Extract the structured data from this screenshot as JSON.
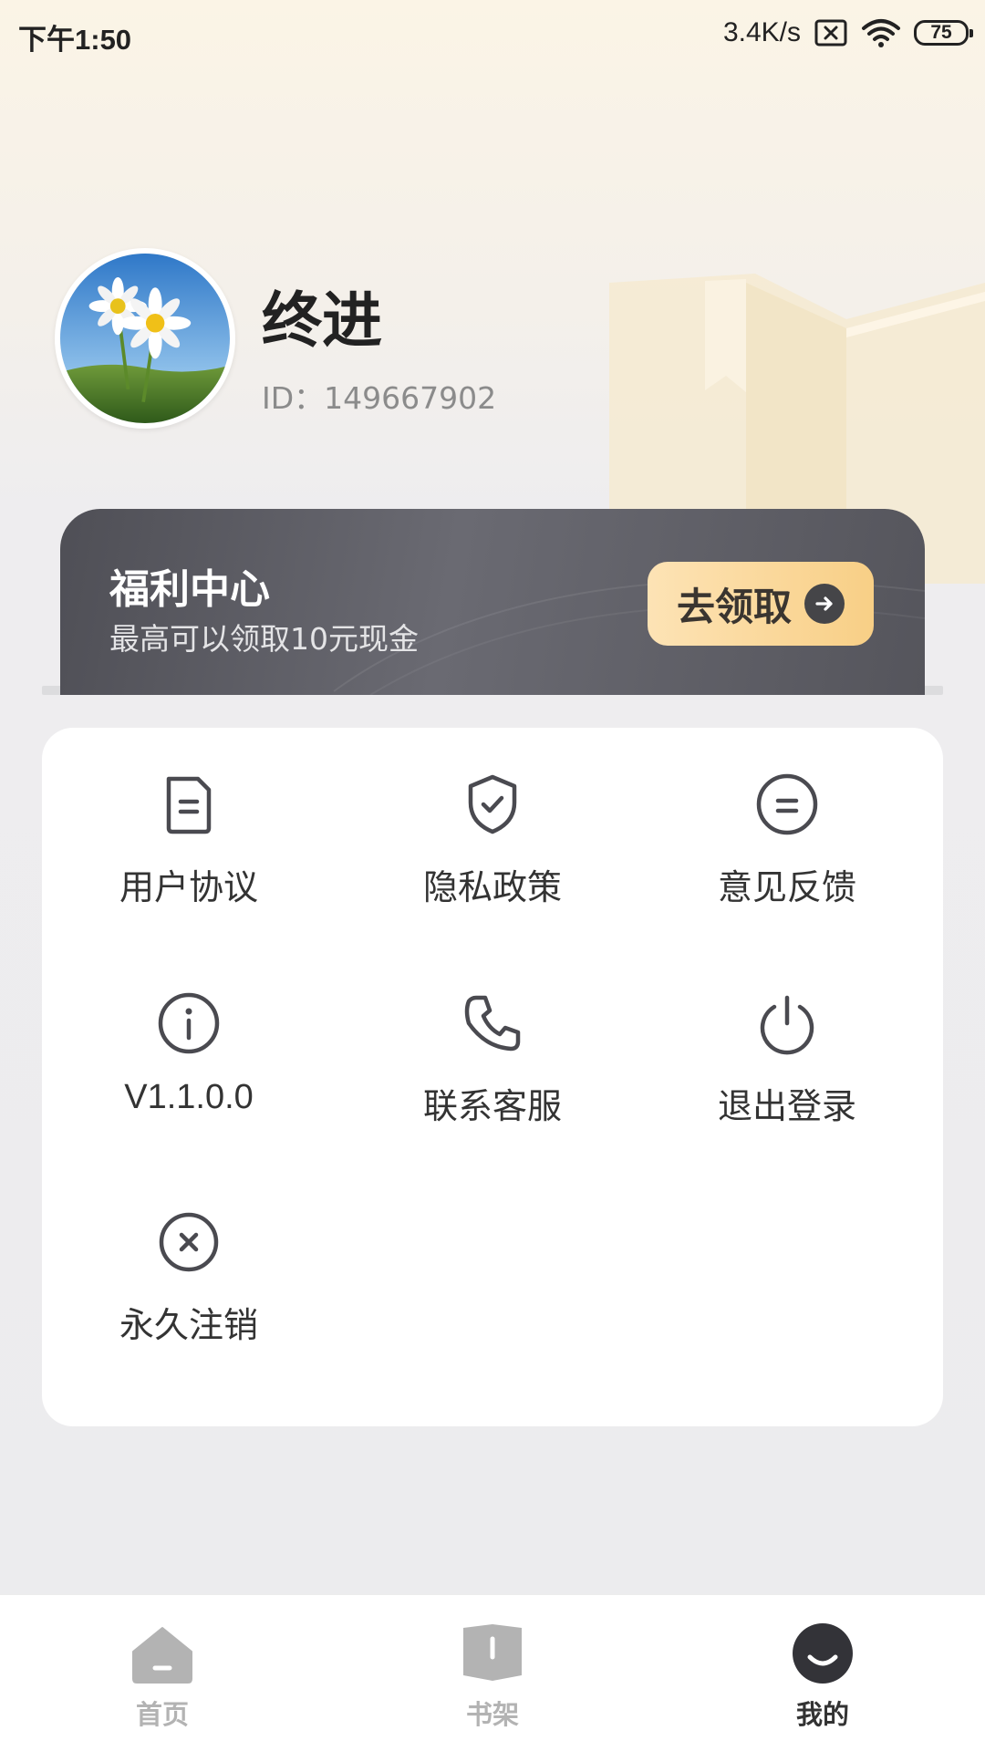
{
  "status_bar": {
    "time": "下午1:50",
    "net_speed": "3.4K/s",
    "battery": "75"
  },
  "profile": {
    "name": "终进",
    "id_text": "ID：149667902",
    "avatar": "daisy-photo"
  },
  "welfare": {
    "title": "福利中心",
    "subtitle": "最高可以领取10元现金",
    "button_label": "去领取"
  },
  "menu": {
    "items": [
      {
        "label": "用户协议",
        "icon": "document-icon"
      },
      {
        "label": "隐私政策",
        "icon": "shield-check-icon"
      },
      {
        "label": "意见反馈",
        "icon": "feedback-icon"
      },
      {
        "label": "V1.1.0.0",
        "icon": "info-icon"
      },
      {
        "label": "联系客服",
        "icon": "phone-icon"
      },
      {
        "label": "退出登录",
        "icon": "power-icon"
      },
      {
        "label": "永久注销",
        "icon": "close-circle-icon"
      }
    ]
  },
  "nav": {
    "items": [
      {
        "label": "首页",
        "icon": "home-icon",
        "active": false
      },
      {
        "label": "书架",
        "icon": "bookshelf-icon",
        "active": false
      },
      {
        "label": "我的",
        "icon": "profile-face-icon",
        "active": true
      }
    ]
  },
  "colors": {
    "accent_gold": "#f8cf86",
    "banner_dark": "#55555c",
    "icon_stroke": "#4a4a50",
    "nav_inactive": "#b3b3b3"
  }
}
